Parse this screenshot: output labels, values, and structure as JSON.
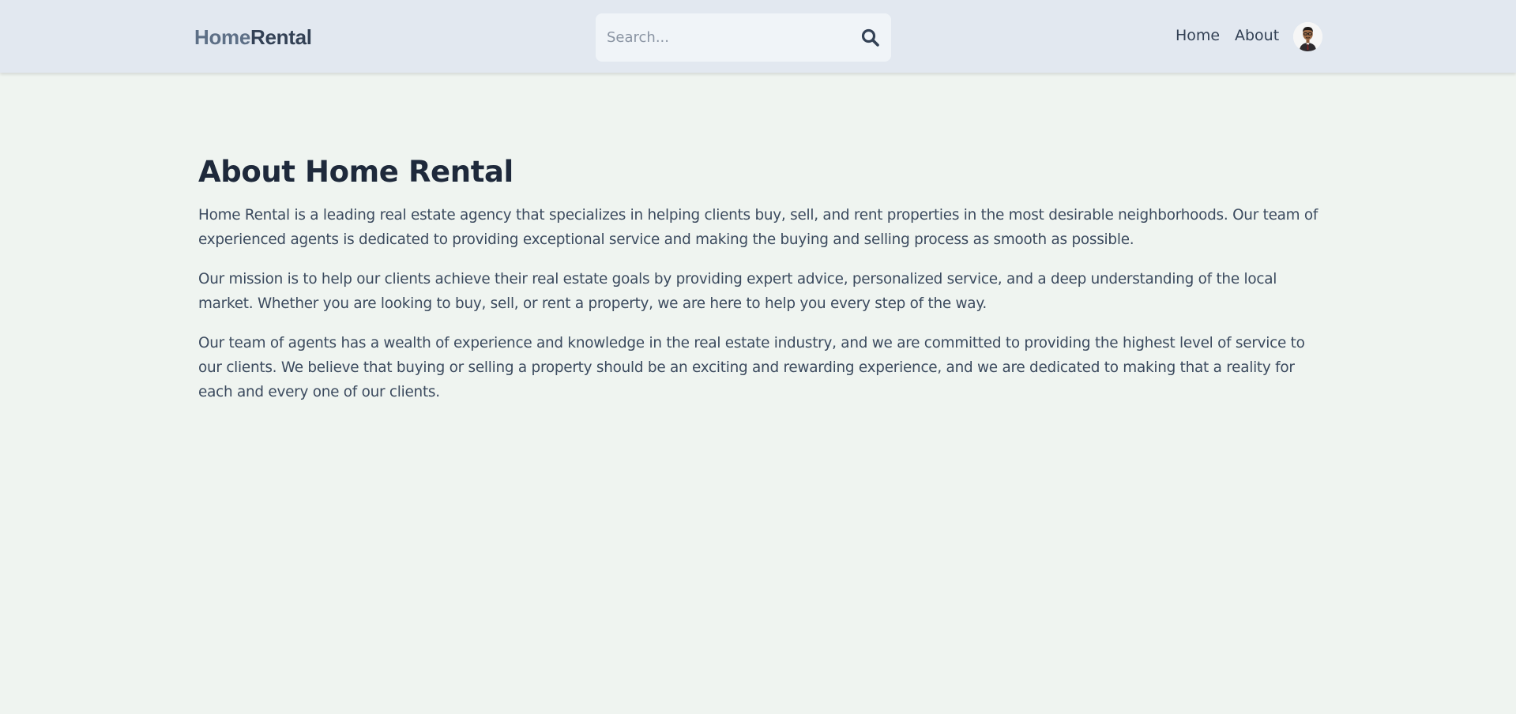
{
  "navbar": {
    "brand": {
      "part1": "Home",
      "part2": "Rental"
    },
    "search": {
      "placeholder": "Search...",
      "value": "",
      "icon": "search-icon"
    },
    "links": {
      "home": "Home",
      "about": "About"
    },
    "avatar": {
      "icon": "user-avatar"
    }
  },
  "colors": {
    "navbar_bg": "#e2e8f0",
    "page_bg": "#eff4f0",
    "heading": "#1e293b",
    "body_text": "#3b4a5e",
    "brand_home": "#5d6f86",
    "brand_rental": "#334155"
  },
  "main": {
    "title": "About Home Rental",
    "paragraphs": [
      "Home Rental is a leading real estate agency that specializes in helping clients buy, sell, and rent properties in the most desirable neighborhoods. Our team of experienced agents is dedicated to providing exceptional service and making the buying and selling process as smooth as possible.",
      "Our mission is to help our clients achieve their real estate goals by providing expert advice, personalized service, and a deep understanding of the local market. Whether you are looking to buy, sell, or rent a property, we are here to help you every step of the way.",
      "Our team of agents has a wealth of experience and knowledge in the real estate industry, and we are committed to providing the highest level of service to our clients. We believe that buying or selling a property should be an exciting and rewarding experience, and we are dedicated to making that a reality for each and every one of our clients."
    ]
  }
}
